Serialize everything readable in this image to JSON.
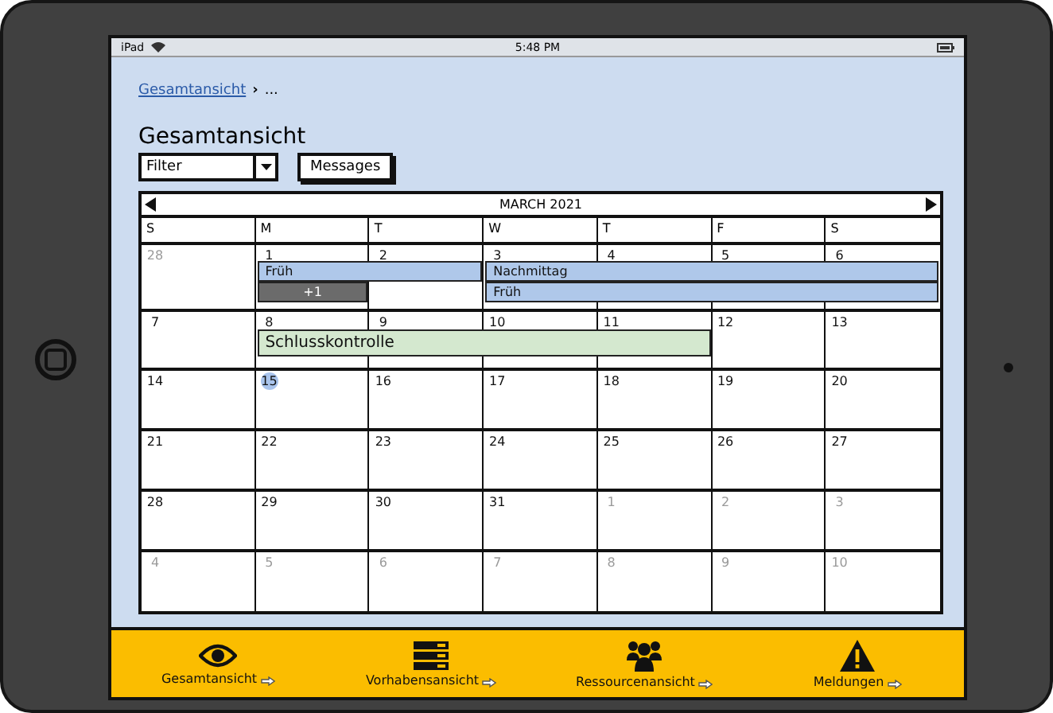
{
  "status_bar": {
    "device": "iPad",
    "time": "5:48 PM"
  },
  "breadcrumb": {
    "link": "Gesamtansicht",
    "separator": "›",
    "rest": "..."
  },
  "title": "Gesamtansicht",
  "filter": {
    "value": "Filter"
  },
  "messages_button": "Messages",
  "calendar": {
    "month": "MARCH 2021",
    "weekdays": [
      "S",
      "M",
      "T",
      "W",
      "T",
      "F",
      "S"
    ],
    "weeks": [
      {
        "days": [
          {
            "label": "28",
            "in_month": false,
            "today": false
          },
          {
            "label": "1",
            "in_month": true,
            "today": false,
            "events": [
              {
                "kind": "start",
                "label": "Früh",
                "color": "#afc8ea"
              },
              {
                "kind": "more",
                "label": "+1",
                "color": "#6b6b6b"
              }
            ]
          },
          {
            "label": "2",
            "in_month": true,
            "today": false,
            "events": [
              {
                "kind": "continue"
              },
              {
                "kind": "gap"
              }
            ]
          },
          {
            "label": "3",
            "in_month": true,
            "today": false,
            "events": [
              {
                "kind": "start",
                "label": "Nachmittag",
                "color": "#afc8ea"
              },
              {
                "kind": "start",
                "label": "Früh",
                "color": "#afc8ea"
              }
            ]
          },
          {
            "label": "4",
            "in_month": true,
            "today": false,
            "events": [
              {
                "kind": "continue"
              },
              {
                "kind": "continue"
              }
            ]
          },
          {
            "label": "5",
            "in_month": true,
            "today": false,
            "events": [
              {
                "kind": "continue"
              },
              {
                "kind": "continue"
              }
            ]
          },
          {
            "label": "6",
            "in_month": true,
            "today": false,
            "events": [
              {
                "kind": "continue"
              },
              {
                "kind": "continue"
              }
            ]
          }
        ]
      },
      {
        "days": [
          {
            "label": "7",
            "in_month": true,
            "today": false
          },
          {
            "label": "8",
            "in_month": true,
            "today": false,
            "events": [
              {
                "kind": "start",
                "label": "Schlusskontrolle",
                "color": "#d4e8cf"
              }
            ]
          },
          {
            "label": "9",
            "in_month": true,
            "today": false,
            "events": [
              {
                "kind": "continue"
              }
            ]
          },
          {
            "label": "10",
            "in_month": true,
            "today": false,
            "events": [
              {
                "kind": "continue"
              }
            ]
          },
          {
            "label": "11",
            "in_month": true,
            "today": false,
            "events": [
              {
                "kind": "continue"
              }
            ]
          },
          {
            "label": "12",
            "in_month": true,
            "today": false
          },
          {
            "label": "13",
            "in_month": true,
            "today": false
          }
        ]
      },
      {
        "days": [
          {
            "label": "14",
            "in_month": true,
            "today": false
          },
          {
            "label": "15",
            "in_month": true,
            "today": true
          },
          {
            "label": "16",
            "in_month": true,
            "today": false
          },
          {
            "label": "17",
            "in_month": true,
            "today": false
          },
          {
            "label": "18",
            "in_month": true,
            "today": false
          },
          {
            "label": "19",
            "in_month": true,
            "today": false
          },
          {
            "label": "20",
            "in_month": true,
            "today": false
          }
        ]
      },
      {
        "days": [
          {
            "label": "21",
            "in_month": true,
            "today": false
          },
          {
            "label": "22",
            "in_month": true,
            "today": false
          },
          {
            "label": "23",
            "in_month": true,
            "today": false
          },
          {
            "label": "24",
            "in_month": true,
            "today": false
          },
          {
            "label": "25",
            "in_month": true,
            "today": false
          },
          {
            "label": "26",
            "in_month": true,
            "today": false
          },
          {
            "label": "27",
            "in_month": true,
            "today": false
          }
        ]
      },
      {
        "days": [
          {
            "label": "28",
            "in_month": true,
            "today": false
          },
          {
            "label": "29",
            "in_month": true,
            "today": false
          },
          {
            "label": "30",
            "in_month": true,
            "today": false
          },
          {
            "label": "31",
            "in_month": true,
            "today": false
          },
          {
            "label": "1",
            "in_month": false,
            "today": false
          },
          {
            "label": "2",
            "in_month": false,
            "today": false
          },
          {
            "label": "3",
            "in_month": false,
            "today": false
          }
        ]
      },
      {
        "days": [
          {
            "label": "4",
            "in_month": false,
            "today": false
          },
          {
            "label": "5",
            "in_month": false,
            "today": false
          },
          {
            "label": "6",
            "in_month": false,
            "today": false
          },
          {
            "label": "7",
            "in_month": false,
            "today": false
          },
          {
            "label": "8",
            "in_month": false,
            "today": false
          },
          {
            "label": "9",
            "in_month": false,
            "today": false
          },
          {
            "label": "10",
            "in_month": false,
            "today": false
          }
        ]
      }
    ]
  },
  "tab_bar": [
    {
      "kind": "eye",
      "label": "Gesamtansicht"
    },
    {
      "kind": "list",
      "label": "Vorhabensansicht"
    },
    {
      "kind": "people",
      "label": "Ressourcenansicht"
    },
    {
      "kind": "warning",
      "label": "Meldungen"
    }
  ]
}
